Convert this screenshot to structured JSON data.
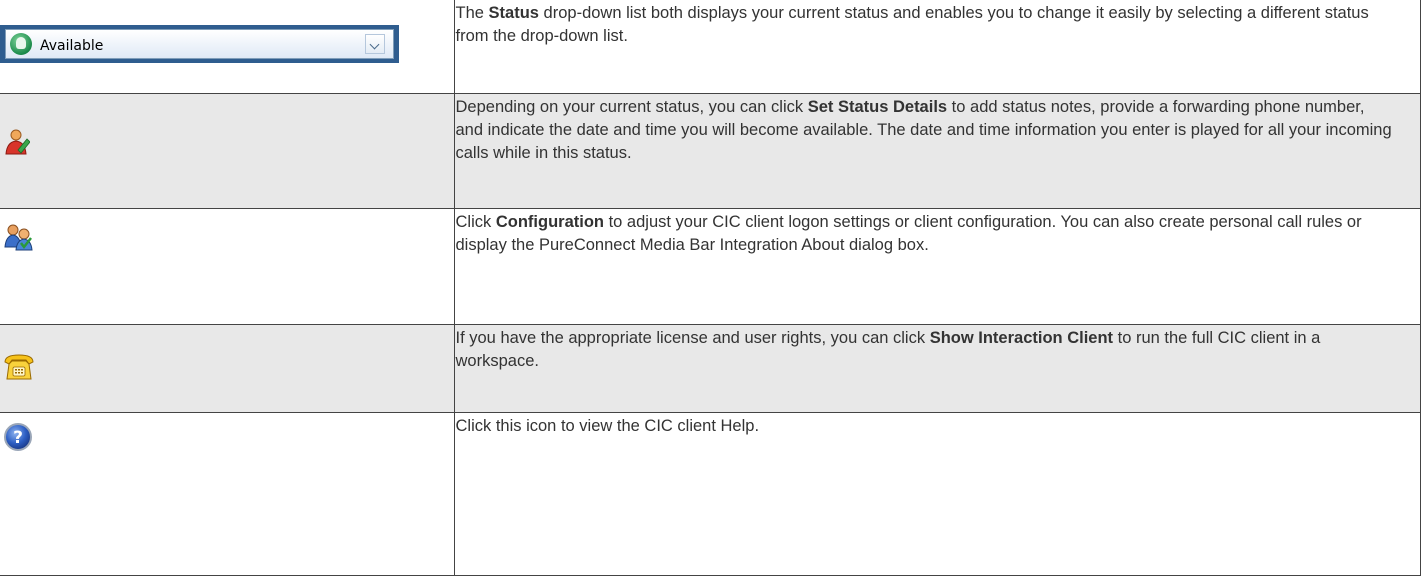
{
  "status_widget": {
    "selected_value": "Available"
  },
  "rows": [
    {
      "icon": "status-dropdown",
      "segments": [
        {
          "t": "The ",
          "b": false
        },
        {
          "t": "Status",
          "b": true
        },
        {
          "t": " drop-down list both displays your current status and enables you to change it easily by selecting a different status from the drop-down list.",
          "b": false
        }
      ]
    },
    {
      "icon": "set-status-details-icon",
      "segments": [
        {
          "t": "Depending on your current status, you can click ",
          "b": false
        },
        {
          "t": "Set Status Details",
          "b": true
        },
        {
          "t": " to add status notes, provide a forwarding phone number, and indicate the date and time you will become available. The date and time information you enter is played for all your incoming calls while in this status.",
          "b": false
        }
      ]
    },
    {
      "icon": "configuration-icon",
      "segments": [
        {
          "t": "Click ",
          "b": false
        },
        {
          "t": "Configuration",
          "b": true
        },
        {
          "t": " to adjust your CIC client logon settings or client configuration. You can also create personal call rules or display the PureConnect Media Bar Integration About dialog box.",
          "b": false
        }
      ]
    },
    {
      "icon": "show-interaction-client-icon",
      "segments": [
        {
          "t": "If you have the appropriate license and user rights, you can click ",
          "b": false
        },
        {
          "t": "Show Interaction Client",
          "b": true
        },
        {
          "t": " to run the full CIC client in a workspace.",
          "b": false
        }
      ]
    },
    {
      "icon": "help-icon",
      "segments": [
        {
          "t": "Click this icon to view the CIC client Help.",
          "b": false
        }
      ]
    }
  ]
}
